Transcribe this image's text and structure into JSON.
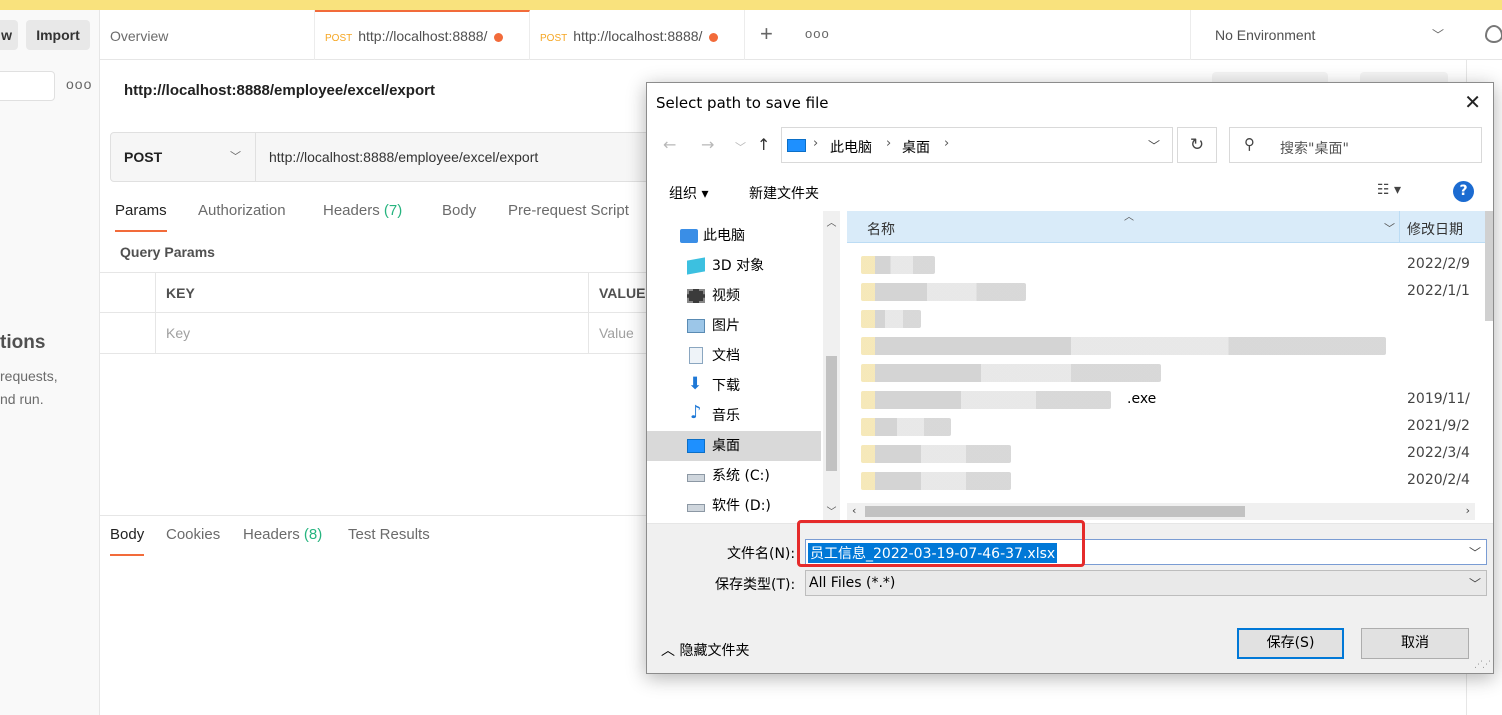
{
  "sidebar": {
    "new_label": "w",
    "import_label": "Import",
    "empty_title": "tions",
    "empty_line1": "requests,",
    "empty_line2": "nd run."
  },
  "tabs": {
    "overview": "Overview",
    "req1_method": "POST",
    "req1_url": "http://localhost:8888/",
    "req2_method": "POST",
    "req2_url": "http://localhost:8888/",
    "plus": "+",
    "more": "ooo"
  },
  "environment": {
    "label": "No Environment"
  },
  "request": {
    "title": "http://localhost:8888/employee/excel/export",
    "method": "POST",
    "url": "http://localhost:8888/employee/excel/export",
    "tabs": {
      "params": "Params",
      "authorization": "Authorization",
      "headers": "Headers",
      "headers_count": "(7)",
      "body": "Body",
      "prerequest": "Pre-request Script"
    },
    "query_params_label": "Query Params",
    "table": {
      "key_header": "KEY",
      "value_header": "VALUE",
      "key_placeholder": "Key",
      "value_placeholder": "Value"
    }
  },
  "response": {
    "tabs": {
      "body": "Body",
      "cookies": "Cookies",
      "headers": "Headers",
      "headers_count": "(8)",
      "test_results": "Test Results"
    }
  },
  "dialog": {
    "title": "Select path to save file",
    "address": {
      "crumb1": "此电脑",
      "crumb2": "桌面"
    },
    "search_placeholder": "搜索\"桌面\"",
    "toolbar": {
      "organize": "组织 ▾",
      "new_folder": "新建文件夹",
      "help": "?"
    },
    "tree": [
      {
        "label": "此电脑",
        "icon": "pc-icon"
      },
      {
        "label": "3D 对象",
        "icon": "3d-objects-icon"
      },
      {
        "label": "视频",
        "icon": "video-icon"
      },
      {
        "label": "图片",
        "icon": "pictures-icon"
      },
      {
        "label": "文档",
        "icon": "documents-icon"
      },
      {
        "label": "下载",
        "icon": "download-icon"
      },
      {
        "label": "音乐",
        "icon": "music-icon"
      },
      {
        "label": "桌面",
        "icon": "desktop-icon"
      },
      {
        "label": "系统 (C:)",
        "icon": "drive-c-icon"
      },
      {
        "label": "软件 (D:)",
        "icon": "drive-d-icon"
      }
    ],
    "columns": {
      "name": "名称",
      "date": "修改日期"
    },
    "files": [
      {
        "ext": "",
        "date": "2022/2/9"
      },
      {
        "ext": "",
        "date": "2022/1/1"
      },
      {
        "ext": "",
        "date": ""
      },
      {
        "ext": "",
        "date": ""
      },
      {
        "ext": "",
        "date": ""
      },
      {
        "ext": ".exe",
        "date": "2019/11/"
      },
      {
        "ext": "",
        "date": "2021/9/2"
      },
      {
        "ext": "",
        "date": "2022/3/4"
      },
      {
        "ext": "",
        "date": "2020/2/4"
      }
    ],
    "filename_label": "文件名(N):",
    "filename_value": "员工信息_2022-03-19-07-46-37.xlsx",
    "filetype_label": "保存类型(T):",
    "filetype_value": "All Files (*.*)",
    "hide_folders": "隐藏文件夹",
    "save_button": "保存(S)",
    "cancel_button": "取消"
  },
  "colors": {
    "accent": "#f26b3a",
    "dialog_highlight": "#e52b2b",
    "selection": "#0078d7"
  }
}
